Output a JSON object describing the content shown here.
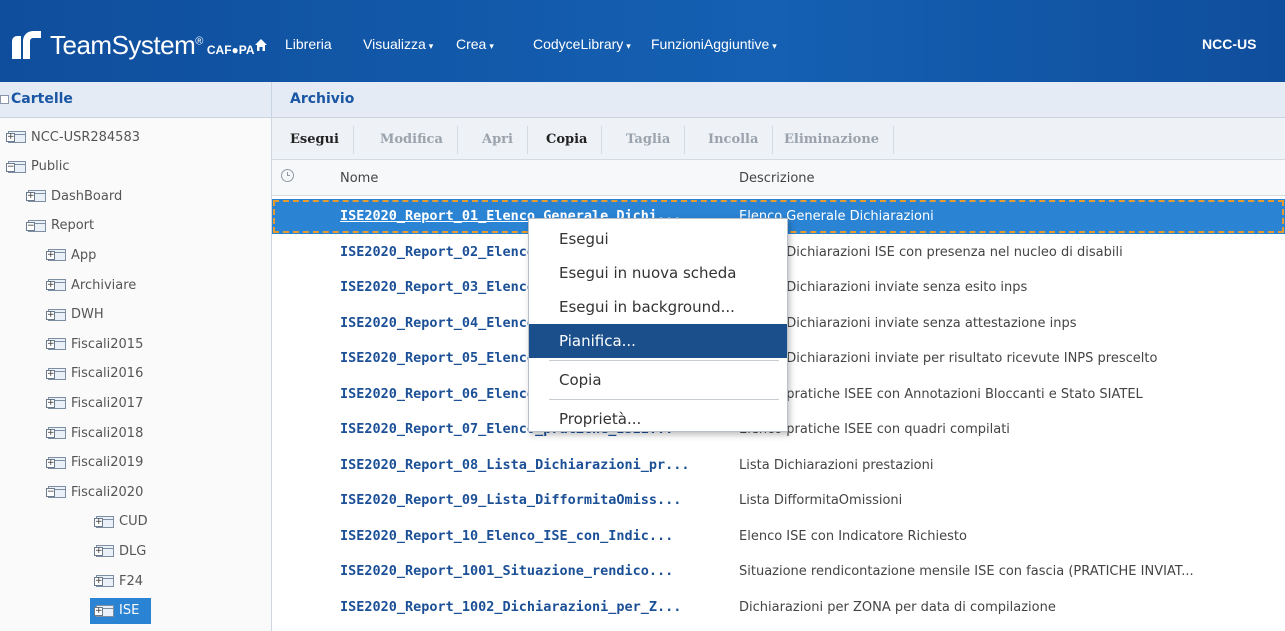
{
  "app": {
    "brand": "TeamSystem",
    "brand_reg": "®",
    "brand_sub": "CAF●PA",
    "user": "NCC-US"
  },
  "nav": {
    "items": [
      {
        "label": "Libreria",
        "dropdown": false
      },
      {
        "label": "Visualizza",
        "dropdown": true
      },
      {
        "label": "Crea",
        "dropdown": true
      },
      {
        "label": "CodyceLibrary",
        "dropdown": true
      },
      {
        "label": "FunzioniAggiuntive",
        "dropdown": true
      }
    ]
  },
  "left_pane": {
    "title": "Cartelle",
    "tree": [
      {
        "label": "NCC-USR284583",
        "level": 0,
        "expanded": false
      },
      {
        "label": "Public",
        "level": 0,
        "expanded": true
      },
      {
        "label": "DashBoard",
        "level": 1,
        "expanded": false
      },
      {
        "label": "Report",
        "level": 1,
        "expanded": true
      },
      {
        "label": "App",
        "level": 2,
        "expanded": false
      },
      {
        "label": "Archiviare",
        "level": 2,
        "expanded": false
      },
      {
        "label": "DWH",
        "level": 2,
        "expanded": false
      },
      {
        "label": "Fiscali2015",
        "level": 2,
        "expanded": false
      },
      {
        "label": "Fiscali2016",
        "level": 2,
        "expanded": false
      },
      {
        "label": "Fiscali2017",
        "level": 2,
        "expanded": false
      },
      {
        "label": "Fiscali2018",
        "level": 2,
        "expanded": false
      },
      {
        "label": "Fiscali2019",
        "level": 2,
        "expanded": false
      },
      {
        "label": "Fiscali2020",
        "level": 2,
        "expanded": true
      },
      {
        "label": "CUD",
        "level": 3,
        "expanded": false
      },
      {
        "label": "DLG",
        "level": 3,
        "expanded": false
      },
      {
        "label": "F24",
        "level": 3,
        "expanded": false
      },
      {
        "label": "ISE",
        "level": 3,
        "expanded": false,
        "selected": true
      }
    ]
  },
  "right_pane": {
    "title": "Archivio",
    "toolbar": [
      {
        "label": "Esegui",
        "enabled": true
      },
      {
        "label": "Modifica",
        "enabled": false
      },
      {
        "label": "Apri",
        "enabled": false
      },
      {
        "label": "Copia",
        "enabled": true
      },
      {
        "label": "Taglia",
        "enabled": false
      },
      {
        "label": "Incolla",
        "enabled": false
      },
      {
        "label": "Eliminazione",
        "enabled": false
      }
    ],
    "columns": {
      "name": "Nome",
      "description": "Descrizione"
    },
    "rows": [
      {
        "name": "ISE2020_Report_01_Elenco_Generale_Dichi...",
        "description": "Elenco Generale Dichiarazioni",
        "selected": true
      },
      {
        "name": "ISE2020_Report_02_Elenco_Dichiarazioni_...",
        "description": "Elenco Dichiarazioni ISE con presenza nel nucleo di disabili"
      },
      {
        "name": "ISE2020_Report_03_Elenco_Dichiarazioni_...",
        "description": "Elenco Dichiarazioni inviate senza esito inps"
      },
      {
        "name": "ISE2020_Report_04_Elenco_Dichiarazioni_...",
        "description": "Elenco Dichiarazioni inviate senza attestazione inps"
      },
      {
        "name": "ISE2020_Report_05_Elenco_Dichiarazioni_...",
        "description": "Elenco Dichiarazioni inviate per risultato ricevute INPS prescelto"
      },
      {
        "name": "ISE2020_Report_06_Elenco_pratiche_ISEE_...",
        "description": "Elenco pratiche ISEE con Annotazioni Bloccanti e Stato SIATEL"
      },
      {
        "name": "ISE2020_Report_07_Elenco_pratiche_ISEE...",
        "description": "Elenco pratiche ISEE con quadri compilati"
      },
      {
        "name": "ISE2020_Report_08_Lista_Dichiarazioni_pr...",
        "description": "Lista Dichiarazioni prestazioni"
      },
      {
        "name": "ISE2020_Report_09_Lista_DifformitaOmiss...",
        "description": "Lista DifformitaOmissioni"
      },
      {
        "name": "ISE2020_Report_10_Elenco_ISE_con_Indic...",
        "description": "Elenco ISE con Indicatore Richiesto"
      },
      {
        "name": "ISE2020_Report_1001_Situazione_rendico...",
        "description": "Situazione rendicontazione mensile ISE con fascia (PRATICHE INVIAT..."
      },
      {
        "name": "ISE2020_Report_1002_Dichiarazioni_per_Z...",
        "description": "Dichiarazioni per ZONA per data di compilazione"
      }
    ]
  },
  "context_menu": {
    "items": [
      {
        "label": "Esegui"
      },
      {
        "label": "Esegui in nuova scheda"
      },
      {
        "label": "Esegui in background..."
      },
      {
        "label": "Pianifica...",
        "highlighted": true
      },
      {
        "separator": true
      },
      {
        "label": "Copia"
      },
      {
        "separator": true
      },
      {
        "label": "Proprietà..."
      }
    ]
  },
  "colors": {
    "topbar": "#1560b3",
    "selection": "#2b83d3",
    "menu_highlight": "#1a4f8b",
    "link": "#1b4f96",
    "focus_outline": "#e69b2e"
  }
}
